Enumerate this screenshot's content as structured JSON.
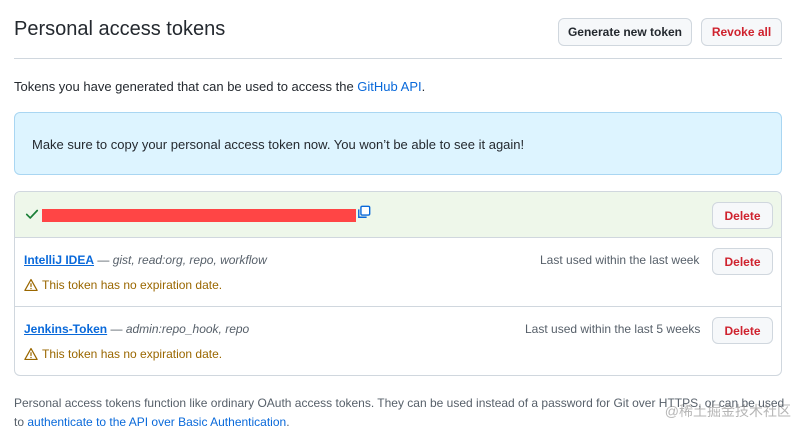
{
  "header": {
    "title": "Personal access tokens",
    "generate_label": "Generate new token",
    "revoke_label": "Revoke all"
  },
  "intro": {
    "text": "Tokens you have generated that can be used to access the ",
    "link": "GitHub API",
    "suffix": "."
  },
  "flash": {
    "message": "Make sure to copy your personal access token now. You won’t be able to see it again!"
  },
  "tokens": {
    "new_token": {
      "delete_label": "Delete"
    },
    "items": [
      {
        "name": "IntelliJ IDEA",
        "separator": " — ",
        "scopes": "gist, read:org, repo, workflow",
        "last_used": "Last used within the last week",
        "warning": "This token has no expiration date.",
        "delete_label": "Delete"
      },
      {
        "name": "Jenkins-Token",
        "separator": " — ",
        "scopes": "admin:repo_hook, repo",
        "last_used": "Last used within the last 5 weeks",
        "warning": "This token has no expiration date.",
        "delete_label": "Delete"
      }
    ]
  },
  "footer": {
    "text": "Personal access tokens function like ordinary OAuth access tokens. They can be used instead of a password for Git over HTTPS, or can be used to ",
    "link": "authenticate to the API over Basic Authentication",
    "suffix": "."
  },
  "watermark": "@稀土掘金技术社区",
  "colors": {
    "accent": "#0969da",
    "danger": "#cf222e",
    "warning": "#9a6700",
    "success": "#1a7f37",
    "flash_bg": "#ddf4ff",
    "new_token_bg": "#eef7ea"
  }
}
